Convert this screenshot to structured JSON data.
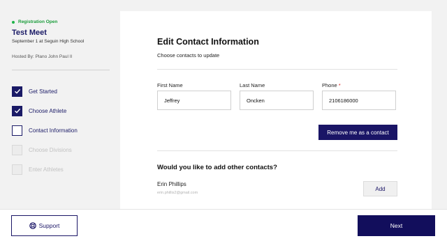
{
  "meet": {
    "status": "Registration Open",
    "title": "Test Meet",
    "subtitle": "September 1 at Seguin High School",
    "hosted_by": "Hosted By: Plano John Paul II"
  },
  "steps": [
    {
      "label": "Get Started",
      "state": "checked"
    },
    {
      "label": "Choose Athlete",
      "state": "checked"
    },
    {
      "label": "Contact Information",
      "state": "current"
    },
    {
      "label": "Choose Divisions",
      "state": "disabled"
    },
    {
      "label": "Enter Athletes",
      "state": "disabled"
    }
  ],
  "form": {
    "title": "Edit Contact Information",
    "subtitle": "Choose contacts to update",
    "first_name_label": "First Name",
    "first_name_value": "Jeffrey",
    "last_name_label": "Last Name",
    "last_name_value": "Oncken",
    "phone_label": "Phone",
    "phone_required": "*",
    "phone_value": "2106186000",
    "remove_label": "Remove me as a contact"
  },
  "other_contacts": {
    "question": "Would you like to add other contacts?",
    "contacts": [
      {
        "name": "Erin Phillips",
        "email": "erin.phillis2@gmail.com",
        "action": "Add"
      }
    ]
  },
  "footer": {
    "support_label": "Support",
    "support_icon": "lifebuoy-icon",
    "next_label": "Next"
  },
  "colors": {
    "primary": "#1a1566",
    "status_green": "#1fb44a",
    "required_red": "#dd2222"
  }
}
